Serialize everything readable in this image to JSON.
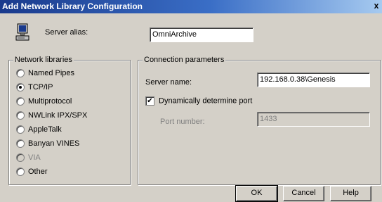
{
  "window": {
    "title": "Add Network Library Configuration",
    "close_label": "x"
  },
  "server_alias": {
    "label": "Server alias:",
    "value": "OmniArchive"
  },
  "network_libraries": {
    "title": "Network libraries",
    "options": [
      {
        "label": "Named Pipes",
        "checked": false,
        "enabled": true
      },
      {
        "label": "TCP/IP",
        "checked": true,
        "enabled": true
      },
      {
        "label": "Multiprotocol",
        "checked": false,
        "enabled": true
      },
      {
        "label": "NWLink IPX/SPX",
        "checked": false,
        "enabled": true
      },
      {
        "label": "AppleTalk",
        "checked": false,
        "enabled": true
      },
      {
        "label": "Banyan VINES",
        "checked": false,
        "enabled": true
      },
      {
        "label": "VIA",
        "checked": false,
        "enabled": false
      },
      {
        "label": "Other",
        "checked": false,
        "enabled": true
      }
    ]
  },
  "connection_parameters": {
    "title": "Connection parameters",
    "server_name_label": "Server name:",
    "server_name_value": "192.168.0.38\\Genesis",
    "dynamic_port_label": "Dynamically determine port",
    "dynamic_port_checked": true,
    "port_number_label": "Port number:",
    "port_number_value": "1433"
  },
  "buttons": {
    "ok": "OK",
    "cancel": "Cancel",
    "help": "Help"
  }
}
